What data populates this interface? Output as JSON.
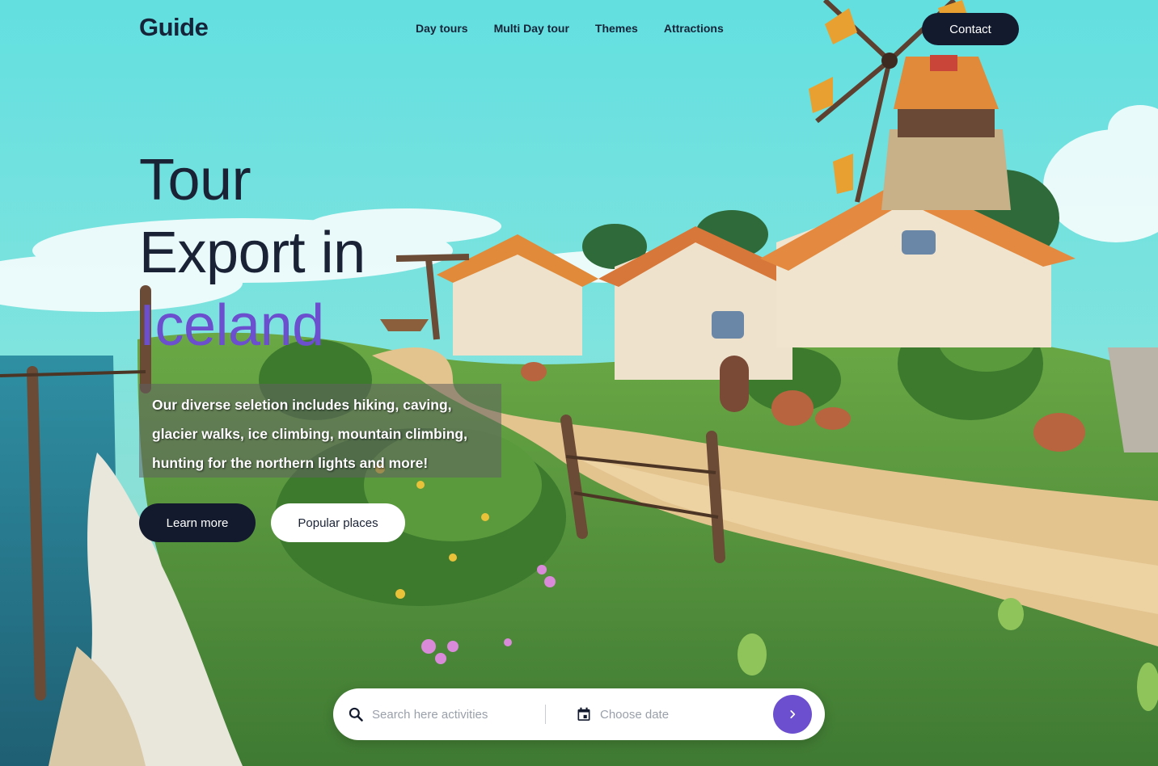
{
  "brand": {
    "logo": "Guide"
  },
  "nav": {
    "items": [
      {
        "label": "Day tours"
      },
      {
        "label": "Multi Day tour"
      },
      {
        "label": "Themes"
      },
      {
        "label": "Attractions"
      }
    ],
    "contact_label": "Contact"
  },
  "hero": {
    "title_line1": "Tour",
    "title_line2": "Export in",
    "title_accent": "Iceland",
    "description": "Our diverse seletion includes hiking, caving, glacier walks, ice climbing, mountain climbing, hunting for the northern lights and more!",
    "primary_label": "Learn more",
    "secondary_label": "Popular places"
  },
  "search": {
    "activities_placeholder": "Search here activities",
    "date_placeholder": "Choose date"
  },
  "colors": {
    "sky": "#66dcdf",
    "dark": "#131a2e",
    "accent": "#6b4fce",
    "grass": "#4f8a37",
    "path": "#e3c48f"
  },
  "icons": [
    "search-icon",
    "calendar-icon",
    "chevron-right-icon"
  ]
}
